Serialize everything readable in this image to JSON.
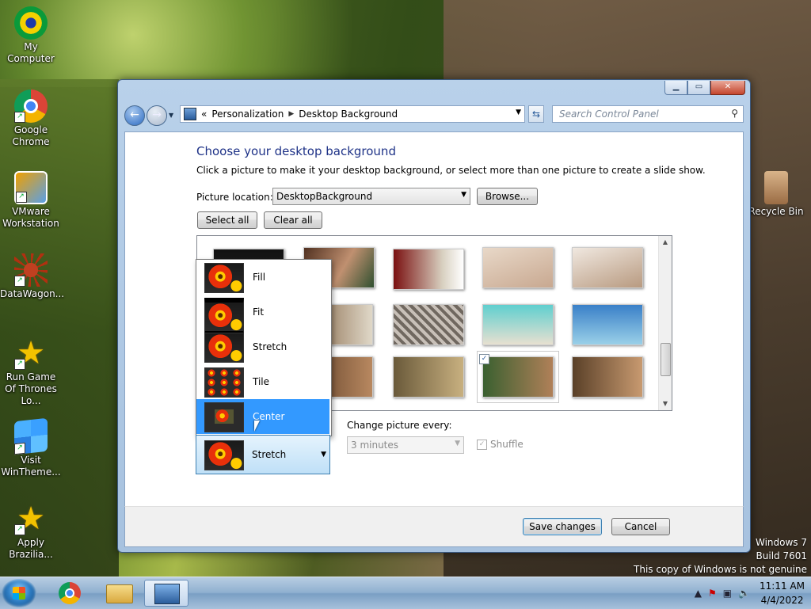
{
  "desktop": {
    "icons": [
      {
        "label": "My Computer"
      },
      {
        "label": "Google Chrome"
      },
      {
        "label": "VMware Workstation"
      },
      {
        "label": "DataWagon..."
      },
      {
        "label": "Run Game Of Thrones Lo..."
      },
      {
        "label": "Visit WinTheme..."
      },
      {
        "label": "Apply Brazilia..."
      },
      {
        "label": "Recycle Bin"
      }
    ],
    "watermark": {
      "line1": "Windows 7",
      "line2": "Build 7601",
      "line3": "This copy of Windows is not genuine"
    }
  },
  "window": {
    "breadcrumb": {
      "overflow": "«",
      "item1": "Personalization",
      "item2": "Desktop Background"
    },
    "search_placeholder": "Search Control Panel",
    "title": "Choose your desktop background",
    "subtitle": "Click a picture to make it your desktop background, or select more than one picture to create a slide show.",
    "picture_location_label": "Picture location:",
    "picture_location_value": "DesktopBackground",
    "browse_label": "Browse...",
    "select_all_label": "Select all",
    "clear_all_label": "Clear all",
    "position_options": [
      {
        "label": "Fill"
      },
      {
        "label": "Fit"
      },
      {
        "label": "Stretch"
      },
      {
        "label": "Tile"
      },
      {
        "label": "Center"
      }
    ],
    "position_selected": "Stretch",
    "position_hover": "Center",
    "change_picture_label": "Change picture every:",
    "interval_value": "3 minutes",
    "shuffle_label": "Shuffle",
    "save_label": "Save changes",
    "cancel_label": "Cancel"
  },
  "taskbar": {
    "time": "11:11 AM",
    "date": "4/4/2022"
  },
  "colors": {
    "title_blue": "#1e3287",
    "selection": "#3399ff",
    "window_frame": "#a7c2df"
  }
}
